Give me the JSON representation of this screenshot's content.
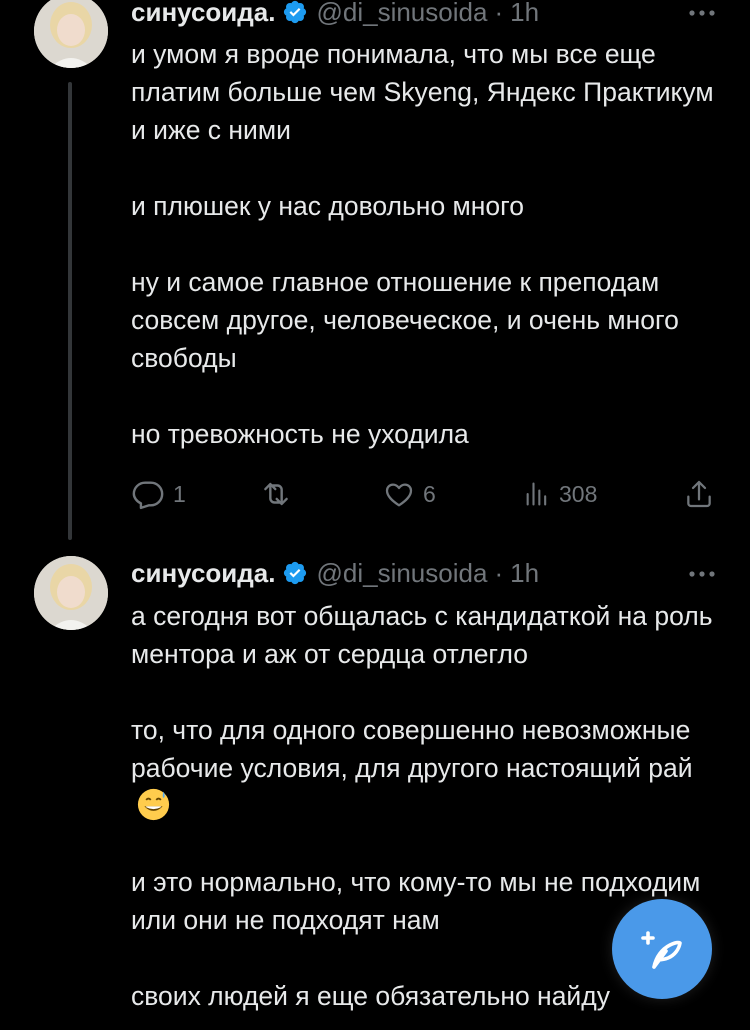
{
  "tweets": [
    {
      "author_name": "синусоида.",
      "handle": "@di_sinusoida",
      "separator": "·",
      "time": "1h",
      "paragraphs": [
        "и умом я вроде понимала, что мы все еще платим больше чем Skyeng, Яндекс Практикум и иже с ними",
        "и плюшек у нас довольно много",
        "ну и самое главное отношение к преподам совсем другое, человеческое, и очень много свободы",
        "но тревожность не уходила"
      ],
      "replies": "1",
      "likes": "6",
      "views": "308"
    },
    {
      "author_name": "синусоида.",
      "handle": "@di_sinusoida",
      "separator": "·",
      "time": "1h",
      "p1": "а сегодня вот общалась с кандидаткой на роль ментора и аж от сердца отлегло",
      "p2": "то, что для одного совершенно невозможные рабочие условия, для другого настоящий рай",
      "p3": "и это нормально, что кому-то мы не подходим или они не подходят нам",
      "p4": "своих людей я еще обязательно найду"
    }
  ],
  "colors": {
    "background": "#000000",
    "text": "#e7e9ea",
    "muted": "#71767b",
    "accent_blue": "#1d9bf0",
    "fab_blue": "#4a99e9"
  },
  "icons": [
    "verified-badge-icon",
    "more-icon",
    "reply-icon",
    "retweet-icon",
    "like-icon",
    "views-icon",
    "share-icon",
    "compose-icon",
    "grinning-sweat-emoji"
  ]
}
